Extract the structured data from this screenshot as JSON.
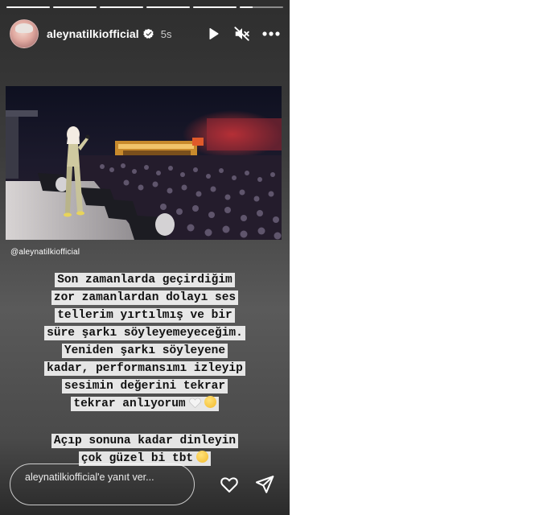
{
  "story": {
    "progress": [
      1,
      1,
      1,
      1,
      1,
      0.3
    ],
    "header": {
      "username": "aleynatilkiofficial",
      "time": "5s",
      "verified": true,
      "icons": [
        "play-icon",
        "mute-icon",
        "more-icon"
      ]
    },
    "mention": "@aleynatilkiofficial",
    "caption_main": [
      "Son zamanlarda geçirdiğim",
      "zor zamanlardan dolayı ses",
      "tellerim yırtılmış ve bir",
      "süre şarkı söyleyemeyeceğim.",
      "Yeniden şarkı söyleyene",
      "kadar, performansımı izleyip",
      "sesimin değerini tekrar",
      "tekrar anlıyorum"
    ],
    "caption_second": [
      "Açıp sonuna kadar dinleyin",
      "çok güzel bi tbt"
    ],
    "emojis": [
      "white-heart-icon",
      "tear-smile-emoji-icon"
    ],
    "reply_placeholder": "aleynatilkiofficial'e yanıt ver...",
    "footer_icons": [
      "heart-icon",
      "send-icon"
    ],
    "colors": {
      "accent": "#ffffff",
      "highlight": "#f2f2f2",
      "text": "#111111"
    }
  }
}
